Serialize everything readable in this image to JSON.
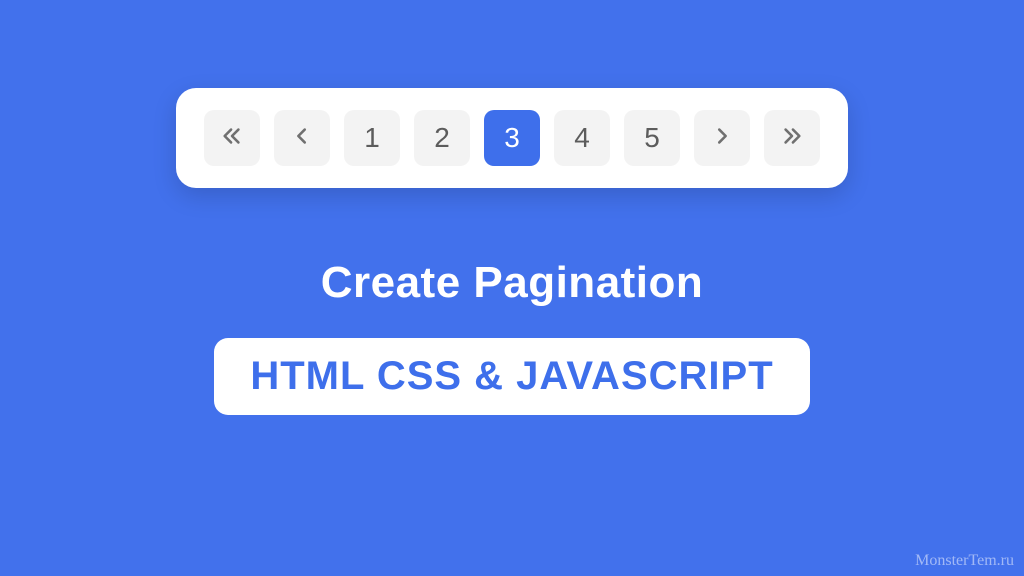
{
  "pagination": {
    "first_icon": "double-chevron-left",
    "prev_icon": "chevron-left",
    "next_icon": "chevron-right",
    "last_icon": "double-chevron-right",
    "pages": [
      "1",
      "2",
      "3",
      "4",
      "5"
    ],
    "active_index": 2
  },
  "heading": "Create Pagination",
  "subtitle": "HTML CSS & JAVASCRIPT",
  "watermark": "MonsterTem.ru"
}
